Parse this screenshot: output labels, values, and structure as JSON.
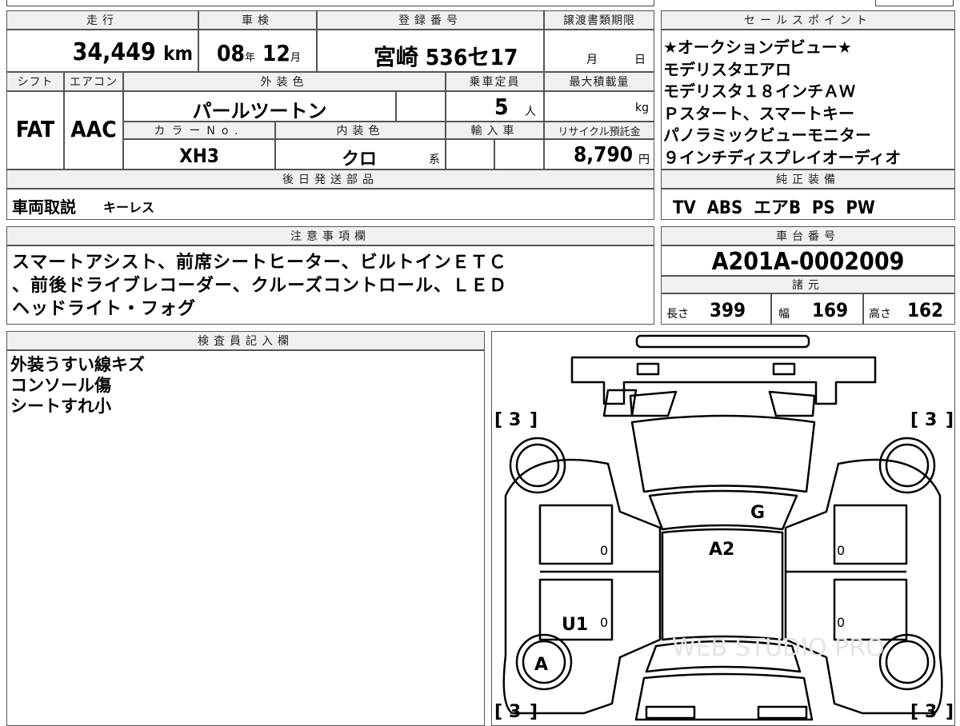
{
  "mileage": {
    "header": "走行",
    "value": "34,449",
    "unit": "km"
  },
  "shaken": {
    "header": "車検",
    "year": "08",
    "year_unit": "年",
    "month": "12",
    "month_unit": "月"
  },
  "registration": {
    "header": "登録番号",
    "value": "宮崎 536セ17"
  },
  "transfer_deadline": {
    "header": "譲渡書類期限",
    "month_unit": "月",
    "day_unit": "日"
  },
  "shift": {
    "header": "シフト",
    "value": "FAT"
  },
  "aircon": {
    "header": "エアコン",
    "value": "AAC"
  },
  "exterior_color": {
    "header": "外装色",
    "value": "パールツートン"
  },
  "capacity": {
    "header": "乗車定員",
    "value": "5",
    "unit": "人"
  },
  "max_load": {
    "header": "最大積載量",
    "unit": "kg"
  },
  "color_no": {
    "header": "カラーNo.",
    "value": "XH3"
  },
  "interior_color": {
    "header": "内装色",
    "value": "クロ",
    "suffix": "系"
  },
  "import": {
    "header": "輸入車"
  },
  "recycle": {
    "header": "リサイクル預託金",
    "value": "8,790",
    "unit": "円"
  },
  "later_parts": {
    "header": "後日発送部品",
    "value_main": "車両取説",
    "value_sub": "キーレス"
  },
  "selling_points": {
    "header": "セールスポイント",
    "lines": [
      "★オークションデビュー★",
      "モデリスタエアロ",
      "モデリスタ１８インチＡＷ",
      "Ｐスタート、スマートキー",
      "パノラミックビューモニター",
      "９インチディスプレイオーディオ"
    ]
  },
  "standard_equipment": {
    "header": "純正装備",
    "value": "TV  ABS  エアB  PS  PW"
  },
  "notes": {
    "header": "注意事項欄",
    "lines": [
      "スマートアシスト、前席シートヒーター、ビルトインＥＴＣ",
      "、前後ドライブレコーダー、クルーズコントロール、ＬＥＤ",
      "ヘッドライト・フォグ"
    ]
  },
  "chassis": {
    "header": "車台番号",
    "value": "A201A-0002009"
  },
  "specs": {
    "header": "諸元",
    "length_label": "長さ",
    "length": "399",
    "width_label": "幅",
    "width": "169",
    "height_label": "高さ",
    "height": "162"
  },
  "inspector": {
    "header": "検査員記入欄",
    "lines": [
      "外装うすい線キズ",
      "コンソール傷",
      "シートすれ小"
    ]
  },
  "diagram": {
    "tire_fl": "3",
    "tire_fr": "3",
    "tire_rl": "3",
    "tire_rr": "3",
    "mark_g": "G",
    "mark_a2": "A2",
    "mark_u1": "U1",
    "mark_a": "A",
    "zero_1": "0",
    "zero_2": "0",
    "zero_3": "0",
    "zero_4": "0",
    "watermark": "WEB STUDIO PRO"
  }
}
